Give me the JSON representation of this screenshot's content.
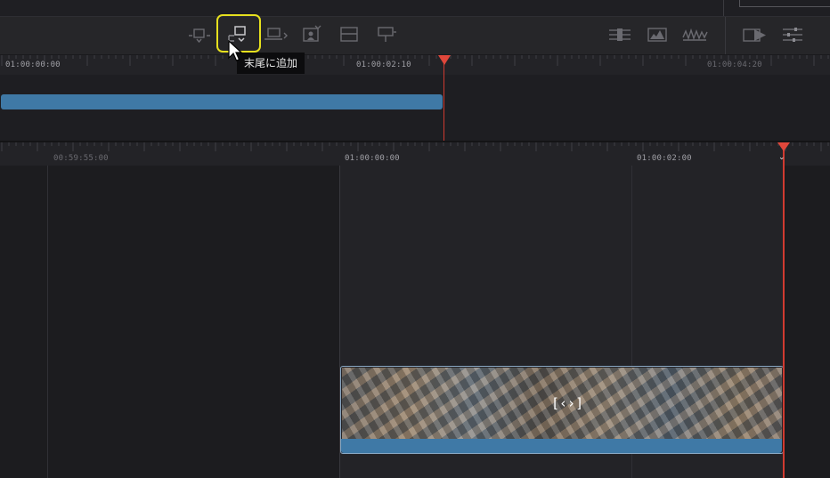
{
  "toolbar": {
    "buttons": [
      {
        "name": "smart-insert-icon"
      },
      {
        "name": "append-to-end-icon"
      },
      {
        "name": "ripple-overwrite-icon"
      },
      {
        "name": "close-up-icon"
      },
      {
        "name": "place-on-top-icon"
      },
      {
        "name": "source-overwrite-icon"
      }
    ],
    "right_buttons": [
      {
        "name": "clip-view-icon"
      },
      {
        "name": "audio-waveform-icon"
      },
      {
        "name": "audio-level-icon"
      },
      {
        "name": "play-timeline-icon"
      },
      {
        "name": "timeline-options-icon"
      }
    ]
  },
  "tooltip": {
    "text": "末尾に追加"
  },
  "source_timeline": {
    "timecodes": [
      "01:00:00:00",
      "01:00:02:10",
      "01:00:04:20"
    ]
  },
  "main_timeline": {
    "timecodes": [
      "00:59:55:00",
      "01:00:00:00",
      "01:00:02:00"
    ]
  },
  "clip": {
    "trim_glyph": "[‹›]"
  },
  "colors": {
    "accent_highlight": "#e6e01e",
    "playhead": "#e0473b",
    "clip_blue": "#3f79a6"
  }
}
